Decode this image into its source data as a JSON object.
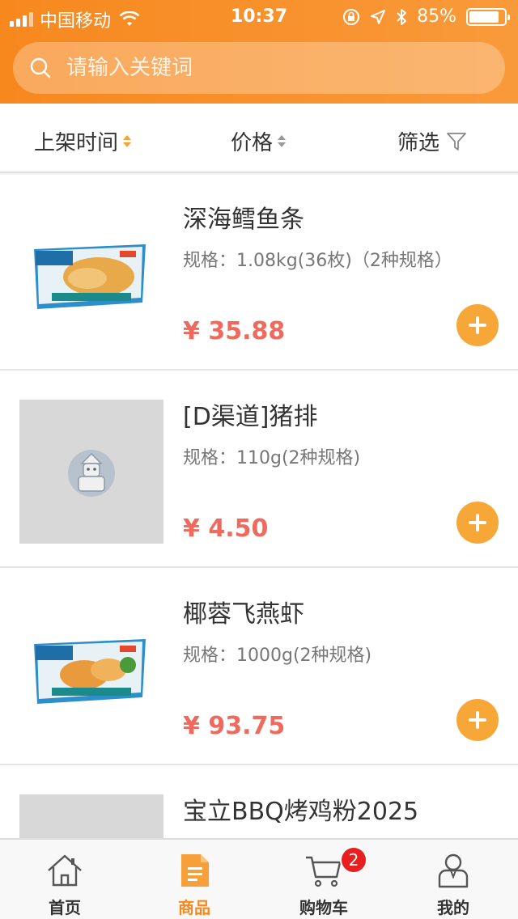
{
  "status_bar": {
    "carrier": "中国移动",
    "time": "10:37",
    "battery": "85%",
    "battery_level": 0.85
  },
  "search": {
    "placeholder": "请输入关键词"
  },
  "sort": {
    "items": [
      {
        "label": "上架时间",
        "type": "sort"
      },
      {
        "label": "价格",
        "type": "sort"
      },
      {
        "label": "筛选",
        "type": "filter"
      }
    ]
  },
  "products": [
    {
      "name": "深海鳕鱼条",
      "spec": "规格：1.08kg(36枚)（2种规格）",
      "price": "¥ 35.88",
      "image": "product-box-fish"
    },
    {
      "name": "[D渠道]猪排",
      "spec": "规格：110g(2种规格)",
      "price": "¥ 4.50",
      "image": "placeholder"
    },
    {
      "name": "椰蓉飞燕虾",
      "spec": "规格：1000g(2种规格)",
      "price": "¥ 93.75",
      "image": "product-box-shrimp"
    },
    {
      "name": "宝立BBQ烤鸡粉2025",
      "spec": "",
      "price": "",
      "image": "placeholder"
    }
  ],
  "tabbar": {
    "tabs": [
      {
        "label": "首页",
        "icon": "home-icon"
      },
      {
        "label": "商品",
        "icon": "document-icon"
      },
      {
        "label": "购物车",
        "icon": "cart-icon"
      },
      {
        "label": "我的",
        "icon": "user-icon"
      }
    ],
    "active_index": 1,
    "cart_badge": "2"
  },
  "colors": {
    "accent": "#f7881e",
    "price": "#ef6a5d",
    "add_button": "#f7a738",
    "badge": "#e81f1f"
  }
}
